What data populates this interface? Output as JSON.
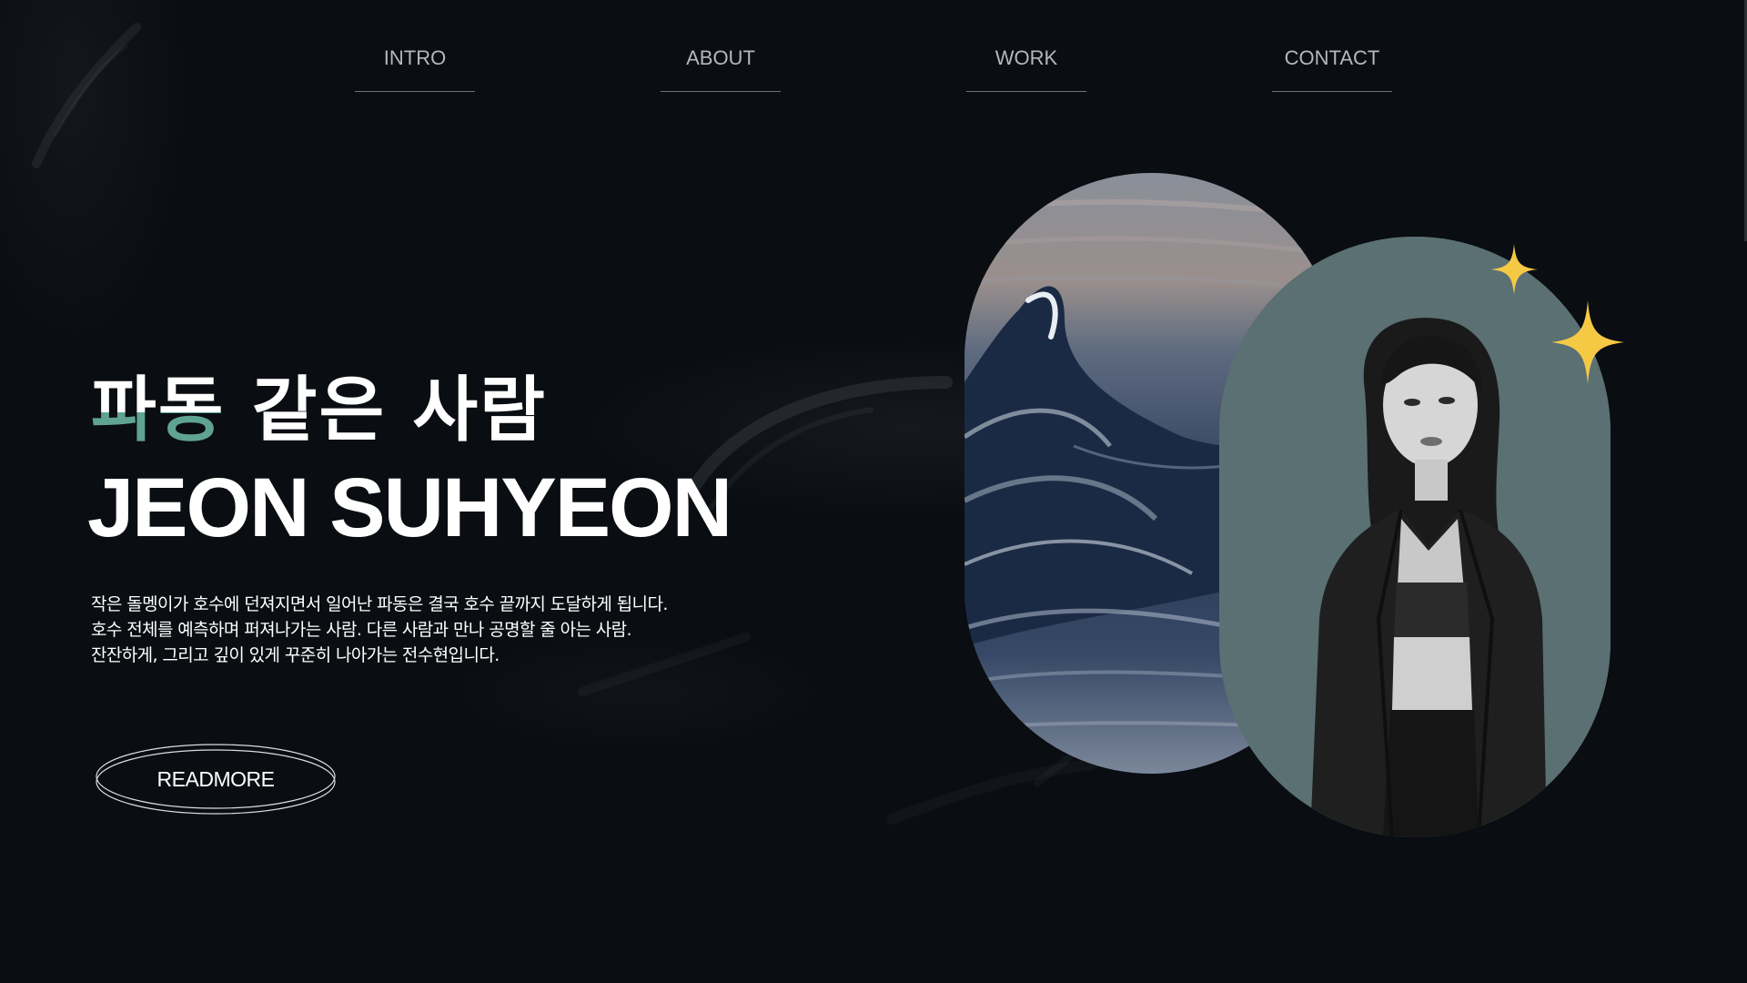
{
  "nav": {
    "items": [
      {
        "label": "INTRO"
      },
      {
        "label": "ABOUT"
      },
      {
        "label": "WORK"
      },
      {
        "label": "CONTACT"
      }
    ]
  },
  "hero": {
    "title_ko_highlight": "파동",
    "title_ko_rest": " 같은 사람",
    "title_en": "JEON SUHYEON",
    "description": [
      "작은 돌멩이가 호수에 던져지면서 일어난 파동은 결국 호수 끝까지 도달하게 됩니다.",
      "호수 전체를 예측하며 퍼져나가는 사람. 다른 사람과 만나 공명할 줄 아는 사람.",
      "잔잔하게, 그리고 깊이 있게 꾸준히 나아가는 전수현입니다."
    ],
    "button_label": "READMORE"
  },
  "colors": {
    "background": "#0a0d11",
    "highlight_teal": "#5fa393",
    "portrait_bg": "#5a7073",
    "sparkle": "#f6c945",
    "nav_text": "#b3b8be"
  },
  "icons": {
    "sparkle": "four-point-star-icon"
  }
}
